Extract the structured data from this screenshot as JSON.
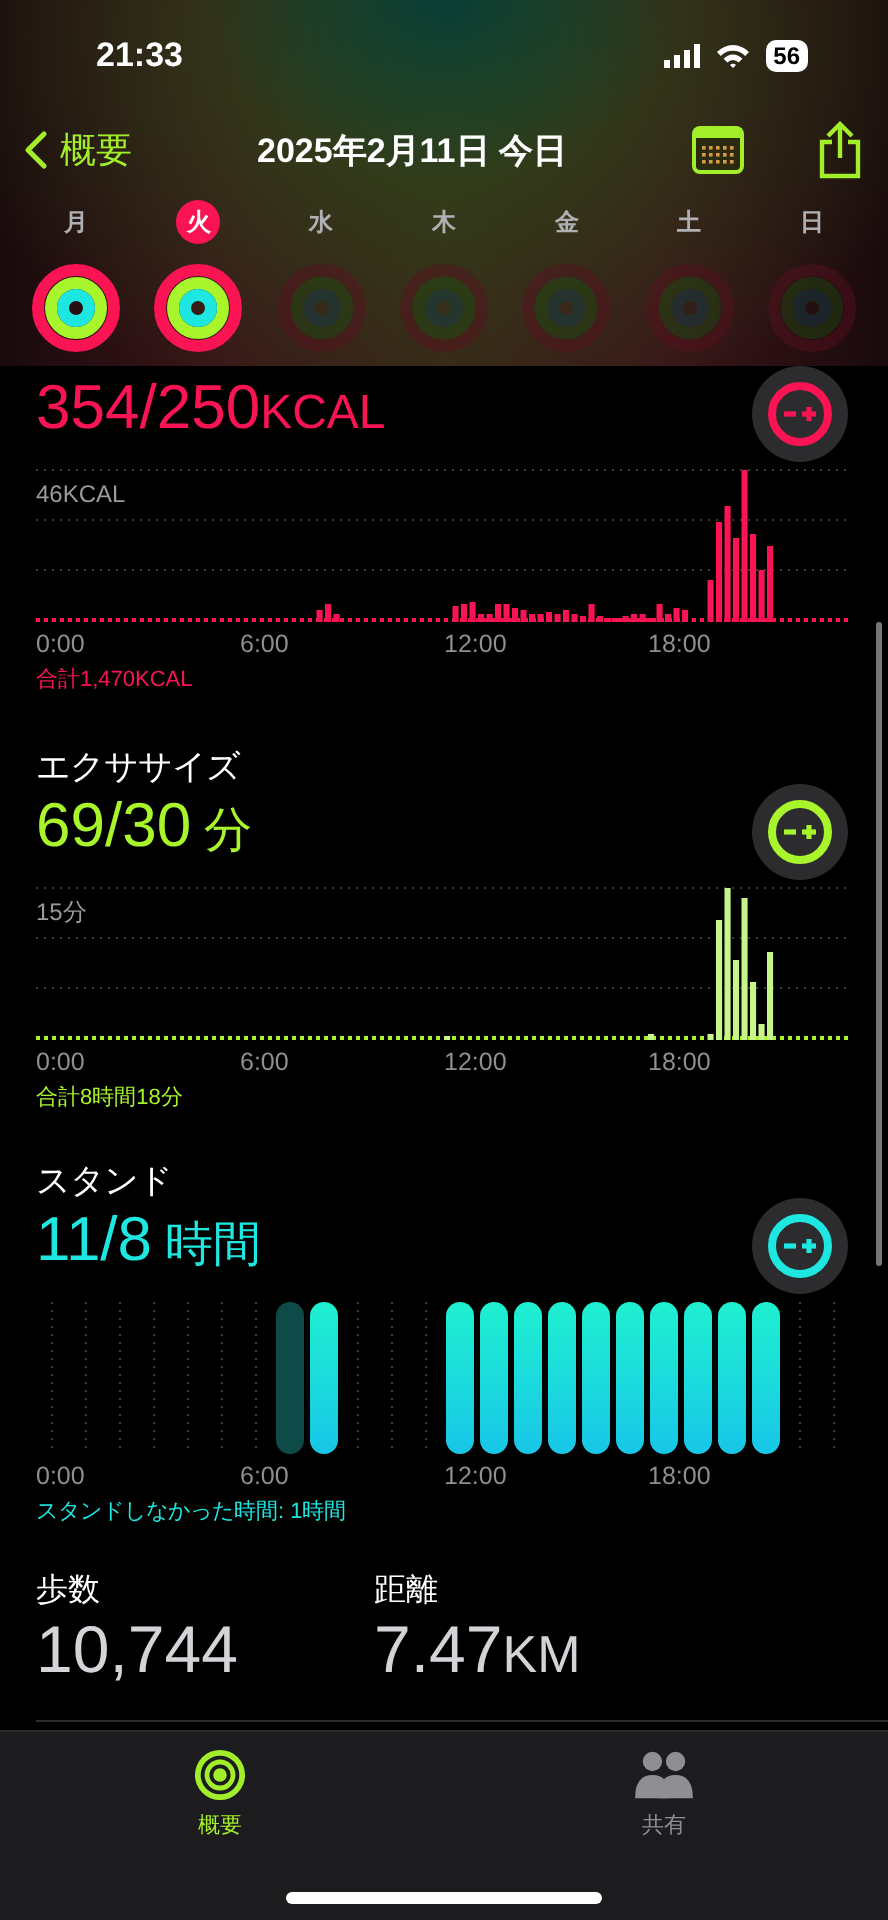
{
  "status_bar": {
    "time": "21:33",
    "battery": "56"
  },
  "nav": {
    "back": "概要",
    "title": "2025年2月11日 今日"
  },
  "days": [
    {
      "label": "月",
      "selected": false,
      "rings_closed": true
    },
    {
      "label": "火",
      "selected": true,
      "rings_closed": true
    },
    {
      "label": "水",
      "selected": false,
      "rings_closed": false
    },
    {
      "label": "木",
      "selected": false,
      "rings_closed": false
    },
    {
      "label": "金",
      "selected": false,
      "rings_closed": false
    },
    {
      "label": "土",
      "selected": false,
      "rings_closed": false
    },
    {
      "label": "日",
      "selected": false,
      "rings_closed": false
    }
  ],
  "sections": [
    {
      "kind": "move",
      "value": "354/250",
      "unit": "KCAL",
      "y_label": "46KCAL",
      "x_labels": [
        "0:00",
        "6:00",
        "12:00",
        "18:00"
      ],
      "footer": "合計1,470KCAL"
    },
    {
      "kind": "exercise",
      "title": "エクササイズ",
      "value": "69/30",
      "unit": " 分",
      "y_label": "15分",
      "x_labels": [
        "0:00",
        "6:00",
        "12:00",
        "18:00"
      ],
      "footer": "合計8時間18分"
    },
    {
      "kind": "stand",
      "title": "スタンド",
      "value": "11/8",
      "unit": " 時間",
      "x_labels": [
        "0:00",
        "6:00",
        "12:00",
        "18:00"
      ],
      "footer": "スタンドしなかった時間: 1時間"
    }
  ],
  "stats": [
    {
      "label": "歩数",
      "value": "10,744"
    },
    {
      "label": "距離",
      "value": "7.47",
      "unit": "KM"
    }
  ],
  "tab_bar": [
    {
      "kind": "summary",
      "label": "概要",
      "selected": true
    },
    {
      "kind": "sharing",
      "label": "共有",
      "selected": false
    }
  ]
}
